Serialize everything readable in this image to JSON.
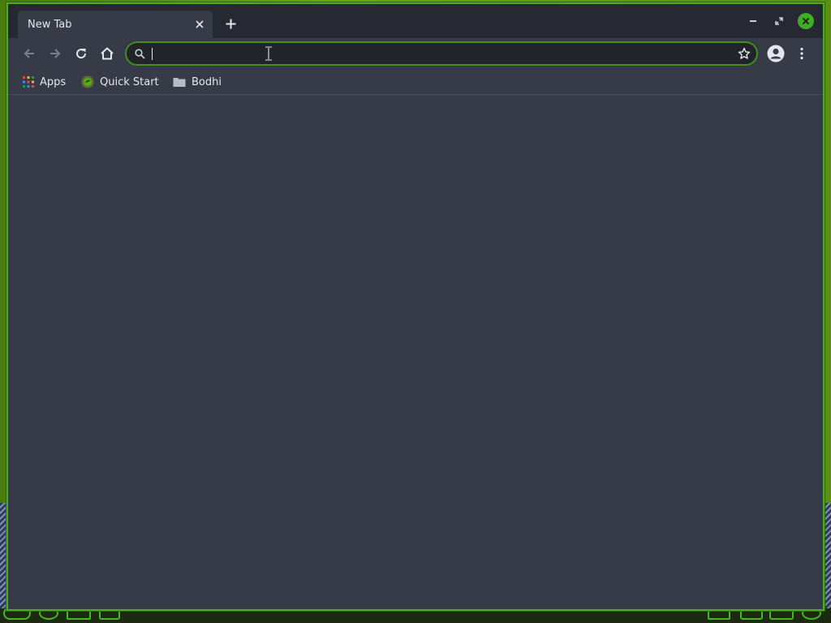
{
  "tab": {
    "title": "New Tab"
  },
  "omnibox": {
    "value": "",
    "placeholder": ""
  },
  "bookmarks": [
    {
      "label": "Apps",
      "icon": "apps-grid-icon"
    },
    {
      "label": "Quick Start",
      "icon": "bodhi-logo-icon"
    },
    {
      "label": "Bodhi",
      "icon": "folder-icon"
    }
  ],
  "colors": {
    "accent": "#4caf1e",
    "window_bg": "#363b47",
    "titlebar_bg": "#262932",
    "omnibox_bg": "#21242b",
    "text": "#e4e6eb"
  }
}
